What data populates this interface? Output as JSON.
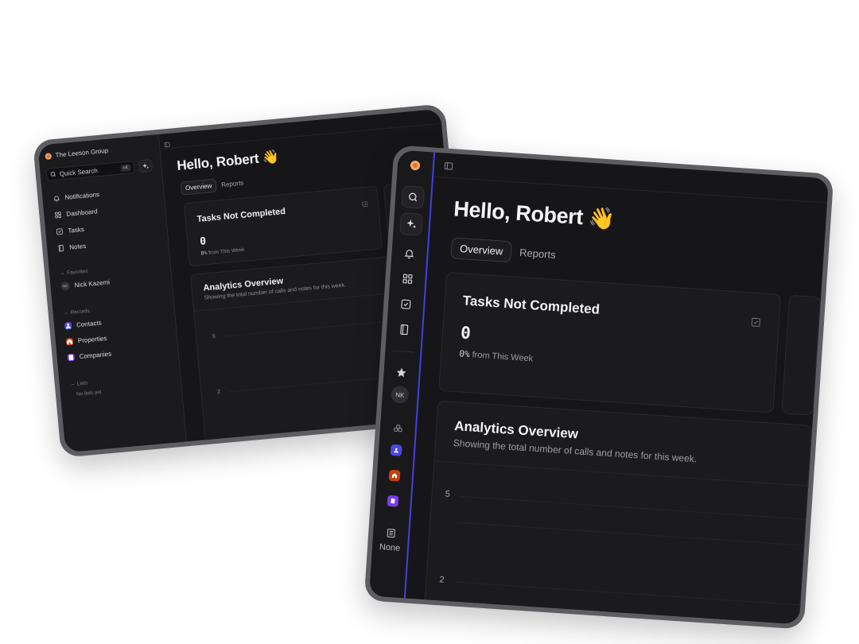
{
  "app": {
    "workspace_name": "The Leeson Group",
    "greeting": "Hello, Robert",
    "greeting_emoji": "👋",
    "accent_color": "#4a3de0"
  },
  "search": {
    "label": "Quick Search",
    "shortcut": "⌘K"
  },
  "sidebar": {
    "nav": [
      {
        "label": "Notifications",
        "icon": "bell-icon"
      },
      {
        "label": "Dashboard",
        "icon": "grid-icon"
      },
      {
        "label": "Tasks",
        "icon": "checkbox-icon"
      },
      {
        "label": "Notes",
        "icon": "notebook-icon"
      }
    ],
    "favorites_label": "Favorites",
    "favorites": [
      {
        "label": "Nick Kazemi",
        "initials": "NK"
      }
    ],
    "records_label": "Records",
    "records": [
      {
        "label": "Contacts",
        "icon": "contact-icon",
        "color": "#4f46e5"
      },
      {
        "label": "Properties",
        "icon": "building-icon",
        "color": "#c2410c"
      },
      {
        "label": "Companies",
        "icon": "company-icon",
        "color": "#7c3aed"
      }
    ],
    "lists_label": "Lists",
    "lists_empty": "No lists yet"
  },
  "rail": {
    "avatar_initials": "NK",
    "bottom_label": "None"
  },
  "tabs": [
    {
      "label": "Overview",
      "active": true
    },
    {
      "label": "Reports",
      "active": false
    }
  ],
  "tasks_card": {
    "title": "Tasks Not Completed",
    "value": "0",
    "delta_value": "0%",
    "delta_text": "from This Week"
  },
  "analytics": {
    "title": "Analytics Overview",
    "subtitle": "Showing the total number of calls and notes for this week.",
    "y_ticks": [
      "5",
      "2"
    ]
  },
  "chart_data": {
    "type": "line",
    "title": "Analytics Overview",
    "subtitle": "Showing the total number of calls and notes for this week.",
    "y_ticks": [
      5,
      2
    ],
    "grid": true,
    "series": []
  }
}
